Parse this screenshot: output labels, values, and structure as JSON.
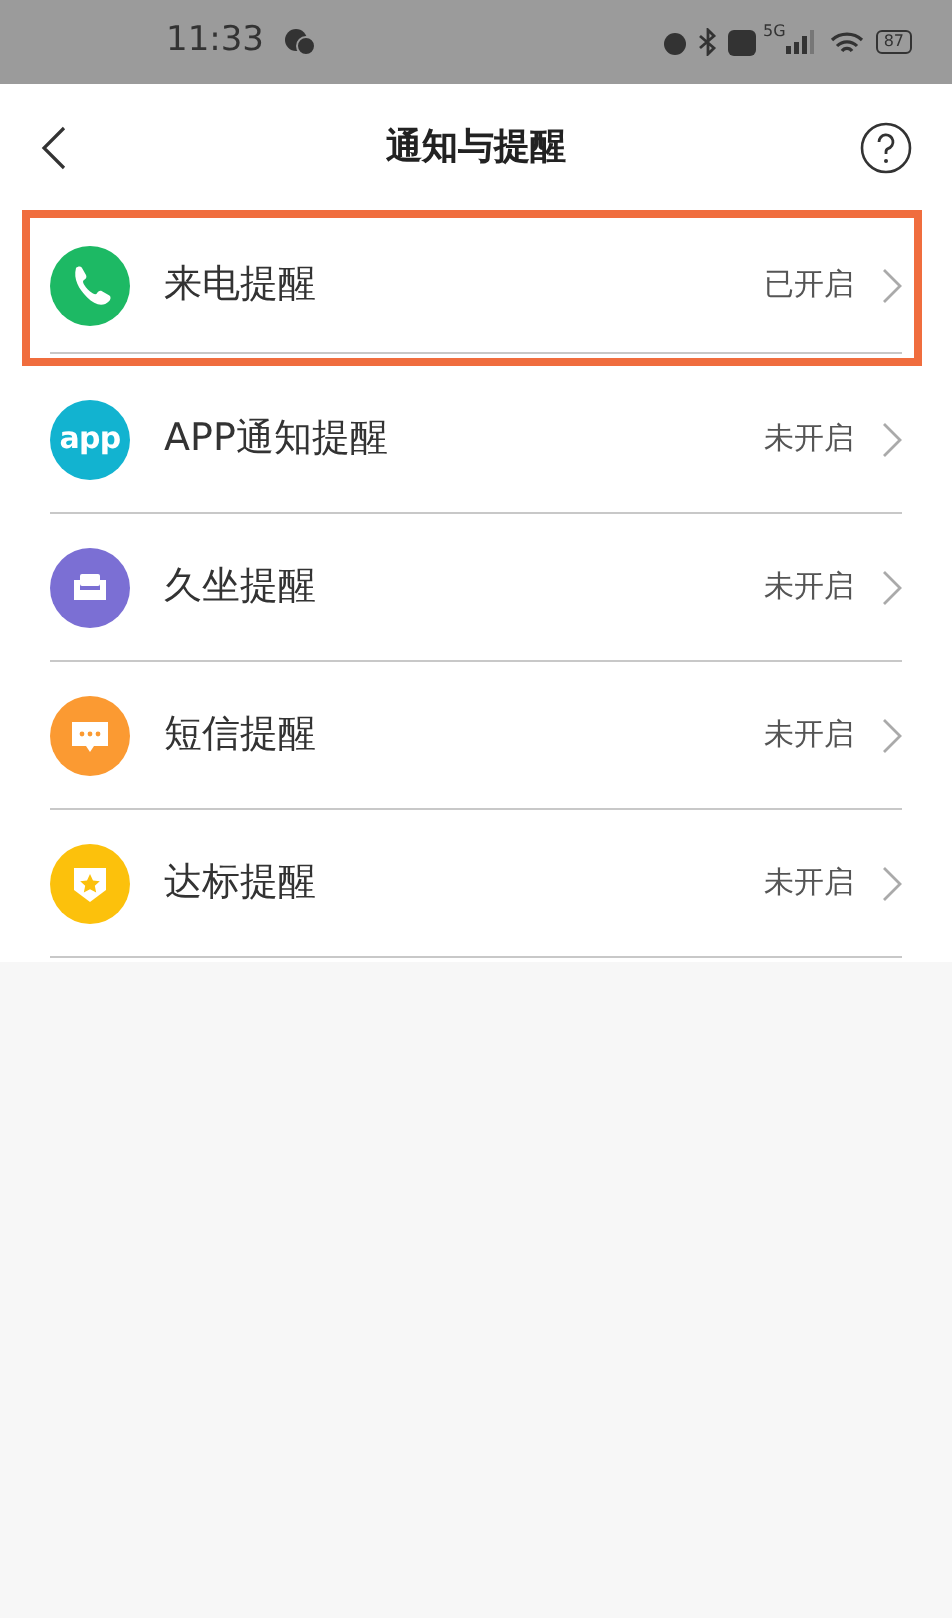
{
  "status_bar": {
    "time": "11:33",
    "network": "5G",
    "battery": "87"
  },
  "header": {
    "title": "通知与提醒"
  },
  "items": [
    {
      "kind": "phone",
      "label": "来电提醒",
      "status": "已开启",
      "color": "#1db964",
      "highlighted": true
    },
    {
      "kind": "app",
      "icon_text": "app",
      "label": "APP通知提醒",
      "status": "未开启",
      "color": "#12b3d0",
      "highlighted": false
    },
    {
      "kind": "sofa",
      "label": "久坐提醒",
      "status": "未开启",
      "color": "#7b6fd4",
      "highlighted": false
    },
    {
      "kind": "message",
      "label": "短信提醒",
      "status": "未开启",
      "color": "#fb9a32",
      "highlighted": false
    },
    {
      "kind": "badge",
      "label": "达标提醒",
      "status": "未开启",
      "color": "#fcc10c",
      "highlighted": false
    }
  ]
}
